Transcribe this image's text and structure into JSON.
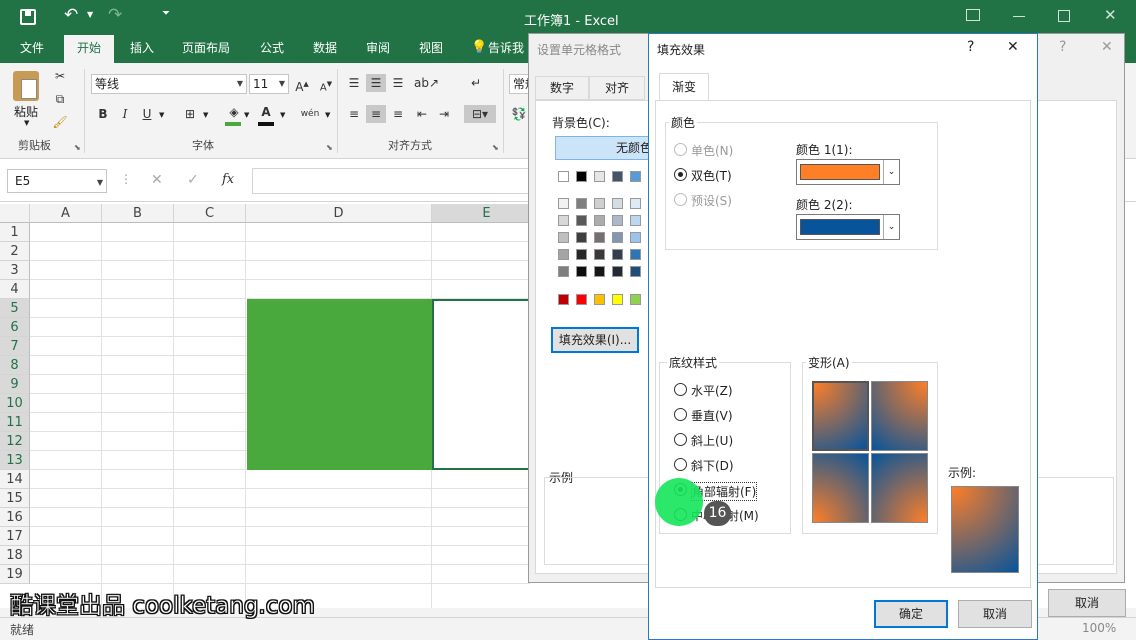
{
  "window": {
    "title": "工作簿1 - Excel"
  },
  "ribbon": {
    "tabs": [
      "文件",
      "开始",
      "插入",
      "页面布局",
      "公式",
      "数据",
      "审阅",
      "视图"
    ],
    "active_tab": "开始",
    "tell_me": "告诉我",
    "paste_label": "粘贴",
    "font_name": "等线",
    "font_size": "11",
    "number_format": "常规",
    "groups": {
      "clipboard": "剪贴板",
      "font": "字体",
      "alignment": "对齐方式"
    },
    "bold": "B",
    "italic": "I",
    "underline": "U"
  },
  "formula_bar": {
    "name_box": "E5",
    "fx": "fx",
    "cancel": "✕",
    "enter": "✓"
  },
  "sheet": {
    "columns": [
      "A",
      "B",
      "C",
      "D",
      "E"
    ],
    "rows": [
      "1",
      "2",
      "3",
      "4",
      "5",
      "6",
      "7",
      "8",
      "9",
      "10",
      "11",
      "12",
      "13",
      "14",
      "15",
      "16",
      "17",
      "18",
      "19"
    ],
    "fill_color": "#4aa93d",
    "fill_range": "D5:D13"
  },
  "status": {
    "ready": "就绪",
    "zoom": "100%"
  },
  "format_dialog": {
    "title": "设置单元格格式",
    "tabs": [
      "数字",
      "对齐"
    ],
    "background_color_label": "背景色(C):",
    "no_color": "无颜色",
    "fill_effects_button": "填充效果(I)...",
    "sample_label": "示例",
    "cancel": "取消",
    "help": "?",
    "close": "✕",
    "palette_rows": [
      [
        "#ffffff",
        "#000000",
        "#e7e6e6",
        "#44546a",
        "#5b9bd5",
        "#ed7d31"
      ],
      [
        "#f2f2f2",
        "#7f7f7f",
        "#d0cece",
        "#d6dce4",
        "#deebf6",
        "#fbe5d5"
      ],
      [
        "#d8d8d8",
        "#595959",
        "#aeabab",
        "#adb9ca",
        "#bdd7ee",
        "#f7cbac"
      ],
      [
        "#bfbfbf",
        "#3f3f3f",
        "#757070",
        "#8496b0",
        "#9dc3e6",
        "#f4b183"
      ],
      [
        "#a5a5a5",
        "#262626",
        "#3a3838",
        "#323f4f",
        "#2e75b5",
        "#c55a11"
      ],
      [
        "#7f7f7f",
        "#0d0d0d",
        "#171616",
        "#222a35",
        "#1e4e79",
        "#833c0b"
      ]
    ],
    "standard_colors": [
      "#c00000",
      "#ff0000",
      "#ffc000",
      "#ffff00",
      "#92d050",
      "#00b050"
    ]
  },
  "fill_effects": {
    "title": "填充效果",
    "help": "?",
    "close": "✕",
    "tab": "渐变",
    "colors_group": "颜色",
    "one_color": "单色(N)",
    "two_colors": "双色(T)",
    "preset": "预设(S)",
    "color1_label": "颜色 1(1):",
    "color2_label": "颜色 2(2):",
    "color1": "#ff7f27",
    "color2": "#07549a",
    "shading_group": "底纹样式",
    "styles": [
      "水平(Z)",
      "垂直(V)",
      "斜上(U)",
      "斜下(D)",
      "角部辐射(F)",
      "中心辐射(M)"
    ],
    "selected_style": "角部辐射(F)",
    "variants_label": "变形(A)",
    "sample_label": "示例:",
    "ok": "确定",
    "cancel": "取消"
  },
  "overlay": {
    "step_badge": "16",
    "watermark": "酷课堂出品 coolketang.com"
  }
}
